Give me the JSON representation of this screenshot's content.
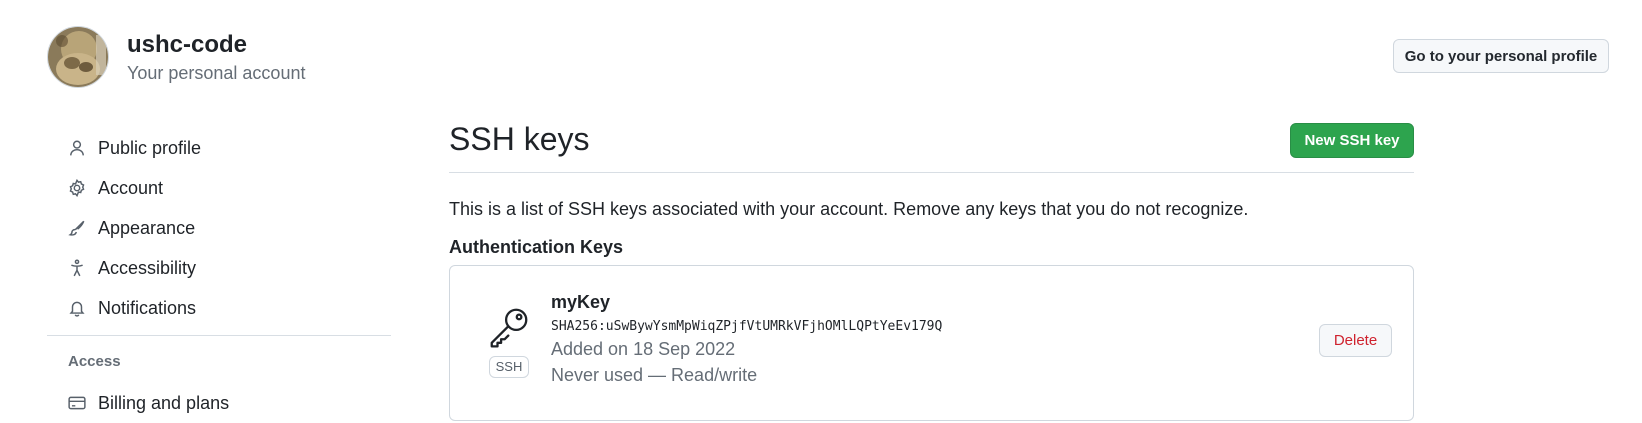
{
  "account": {
    "username": "ushc-code",
    "subtitle": "Your personal account",
    "profile_button": "Go to your personal profile"
  },
  "sidebar": {
    "items": [
      {
        "label": "Public profile",
        "icon": "person-icon"
      },
      {
        "label": "Account",
        "icon": "gear-icon"
      },
      {
        "label": "Appearance",
        "icon": "paintbrush-icon"
      },
      {
        "label": "Accessibility",
        "icon": "accessibility-icon"
      },
      {
        "label": "Notifications",
        "icon": "bell-icon"
      }
    ],
    "group_access": "Access",
    "billing": {
      "label": "Billing and plans",
      "icon": "credit-card-icon"
    }
  },
  "main": {
    "title": "SSH keys",
    "new_key_button": "New SSH key",
    "intro": "This is a list of SSH keys associated with your account. Remove any keys that you do not recognize.",
    "section_title": "Authentication Keys",
    "keys": [
      {
        "name": "myKey",
        "fingerprint": "SHA256:uSwBywYsmMpWiqZPjfVtUMRkVFjhOMlLQPtYeEv179Q",
        "added": "Added on 18 Sep 2022",
        "usage": "Never used — Read/write",
        "badge": "SSH",
        "delete_label": "Delete"
      }
    ]
  },
  "colors": {
    "primary_green": "#2da44e",
    "danger_red": "#cf222e",
    "muted_text": "#656d76",
    "border": "#d0d7de"
  }
}
